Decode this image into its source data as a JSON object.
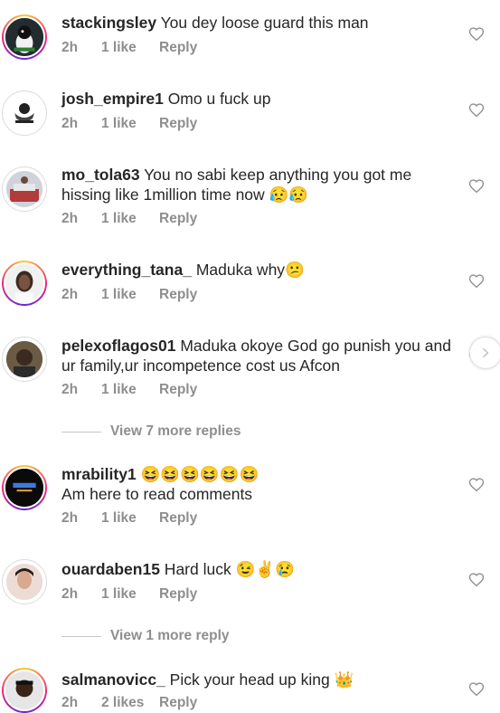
{
  "comments": [
    {
      "username": "stackingsley",
      "text": " You dey loose guard this man",
      "time": "2h",
      "likes": "1 like",
      "reply": "Reply",
      "avatar": "avatar-penguin-icon"
    },
    {
      "username": "josh_empire1",
      "text": " Omo u fuck up",
      "time": "2h",
      "likes": "1 like",
      "reply": "Reply",
      "avatar": "avatar-josh-empire-logo"
    },
    {
      "username": "mo_tola63",
      "text": " You no sabi keep anything you got me hissing like 1million time now 😥😥",
      "time": "2h",
      "likes": "1 like",
      "reply": "Reply",
      "avatar": "avatar-photo"
    },
    {
      "username": "everything_tana_",
      "text": " Maduka why😕",
      "time": "2h",
      "likes": "1 like",
      "reply": "Reply",
      "avatar": "avatar-photo"
    },
    {
      "username": "pelexoflagos01",
      "text": " Maduka okoye God go punish you and ur family,ur incompetence cost us Afcon",
      "time": "2h",
      "likes": "1 like",
      "reply": "Reply",
      "avatar": "avatar-photo"
    },
    {
      "username": "mrability1",
      "text": " 😆😆😆😆😆😆",
      "text2": "Am here to read comments",
      "time": "2h",
      "likes": "1 like",
      "reply": "Reply",
      "avatar": "avatar-dreams-logo"
    },
    {
      "username": "ouardaben15",
      "text": " Hard luck 😉✌️😢",
      "time": "2h",
      "likes": "1 like",
      "reply": "Reply",
      "avatar": "avatar-photo"
    },
    {
      "username": "salmanovicc_",
      "text": " Pick your head up king 👑",
      "time": "2h",
      "likes": "2 likes",
      "reply": "Reply",
      "avatar": "avatar-photo"
    }
  ],
  "view_more": [
    {
      "label": "View 7 more replies"
    },
    {
      "label": "View 1 more reply"
    }
  ],
  "icons": {
    "heart": "heart-outline-icon",
    "next": "chevron-right-icon"
  },
  "colors": {
    "username": "#262626",
    "meta": "#8e8e8e",
    "ring_start": "#f9ce34",
    "ring_end": "#6228d7"
  }
}
